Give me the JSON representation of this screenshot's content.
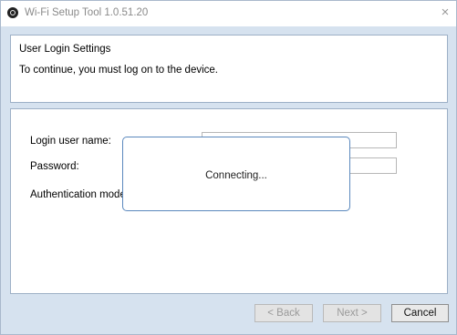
{
  "window": {
    "title": "Wi-Fi Setup Tool 1.0.51.20",
    "close_glyph": "×"
  },
  "header": {
    "title": "User Login Settings",
    "description": "To continue, you must log on to the device."
  },
  "form": {
    "login_label": "Login user name:",
    "login_value": "",
    "password_label": "Password:",
    "password_value": "",
    "auth_label": "Authentication mode:"
  },
  "dialog": {
    "message": "Connecting..."
  },
  "buttons": {
    "back": "< Back",
    "next": "Next >",
    "cancel": "Cancel"
  },
  "colors": {
    "window_background": "#d6e2ef",
    "panel_border": "#9db0c6",
    "dialog_border": "#5a88bd"
  }
}
